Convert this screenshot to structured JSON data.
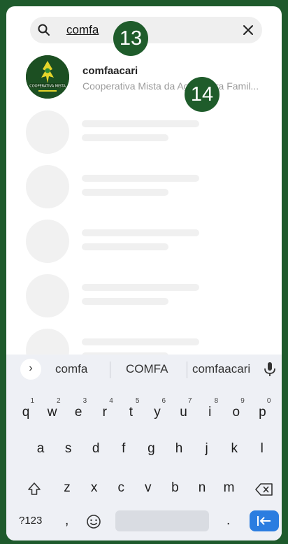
{
  "search": {
    "query": "comfa"
  },
  "markers": {
    "search_marker": "13",
    "result_marker": "14"
  },
  "result": {
    "title": "comfaacari",
    "subtitle": "Cooperativa Mista da Agricultura Famil...",
    "avatar_caption": "COOPERATIVA MISTA"
  },
  "keyboard": {
    "suggestions": [
      "comfa",
      "COMFA",
      "comfaacari"
    ],
    "row1": [
      {
        "k": "q",
        "n": "1"
      },
      {
        "k": "w",
        "n": "2"
      },
      {
        "k": "e",
        "n": "3"
      },
      {
        "k": "r",
        "n": "4"
      },
      {
        "k": "t",
        "n": "5"
      },
      {
        "k": "y",
        "n": "6"
      },
      {
        "k": "u",
        "n": "7"
      },
      {
        "k": "i",
        "n": "8"
      },
      {
        "k": "o",
        "n": "9"
      },
      {
        "k": "p",
        "n": "0"
      }
    ],
    "row2": [
      "a",
      "s",
      "d",
      "f",
      "g",
      "h",
      "j",
      "k",
      "l"
    ],
    "row3": [
      "z",
      "x",
      "c",
      "v",
      "b",
      "n",
      "m"
    ],
    "sym_label": "?123",
    "comma": ",",
    "period": "."
  },
  "colors": {
    "frame": "#1e5a2c",
    "marker": "#1f5c2b",
    "enter": "#2b7de0"
  }
}
